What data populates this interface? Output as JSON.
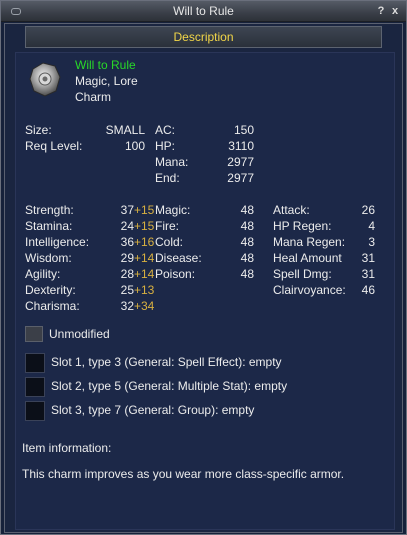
{
  "window": {
    "title": "Will to Rule",
    "help_label": "?",
    "close_label": "x"
  },
  "header": {
    "label": "Description"
  },
  "item": {
    "name": "Will to Rule",
    "flags": "Magic, Lore",
    "type": "Charm"
  },
  "basic": {
    "size_label": "Size:",
    "size_value": "SMALL",
    "req_label": "Req Level:",
    "req_value": "100",
    "ac_label": "AC:",
    "ac_value": "150",
    "hp_label": "HP:",
    "hp_value": "3110",
    "mana_label": "Mana:",
    "mana_value": "2977",
    "end_label": "End:",
    "end_value": "2977"
  },
  "stats": [
    {
      "label": "Strength:",
      "value": "37",
      "bonus": "+15"
    },
    {
      "label": "Stamina:",
      "value": "24",
      "bonus": "+15"
    },
    {
      "label": "Intelligence:",
      "value": "36",
      "bonus": "+16"
    },
    {
      "label": "Wisdom:",
      "value": "29",
      "bonus": "+14"
    },
    {
      "label": "Agility:",
      "value": "28",
      "bonus": "+14"
    },
    {
      "label": "Dexterity:",
      "value": "25",
      "bonus": "+13"
    },
    {
      "label": "Charisma:",
      "value": "32",
      "bonus": "+34"
    }
  ],
  "resists": [
    {
      "label": "Magic:",
      "value": "48"
    },
    {
      "label": "Fire:",
      "value": "48"
    },
    {
      "label": "Cold:",
      "value": "48"
    },
    {
      "label": "Disease:",
      "value": "48"
    },
    {
      "label": "Poison:",
      "value": "48"
    }
  ],
  "mods": [
    {
      "label": "Attack:",
      "value": "26"
    },
    {
      "label": "HP Regen:",
      "value": "4"
    },
    {
      "label": "Mana Regen:",
      "value": "3"
    },
    {
      "label": "Heal Amount",
      "value": "31"
    },
    {
      "label": "Spell Dmg:",
      "value": "31"
    },
    {
      "label": "Clairvoyance:",
      "value": "46"
    }
  ],
  "unmodified_label": "Unmodified",
  "slots": [
    "Slot 1, type 3 (General: Spell Effect): empty",
    "Slot 2, type 5 (General: Multiple Stat): empty",
    "Slot 3, type 7 (General: Group): empty"
  ],
  "info": {
    "heading": "Item information:",
    "description": "This charm improves as you wear more class-specific armor."
  },
  "colors": {
    "name": "#28d828",
    "bonus": "#d8b040",
    "header": "#f2d648"
  }
}
